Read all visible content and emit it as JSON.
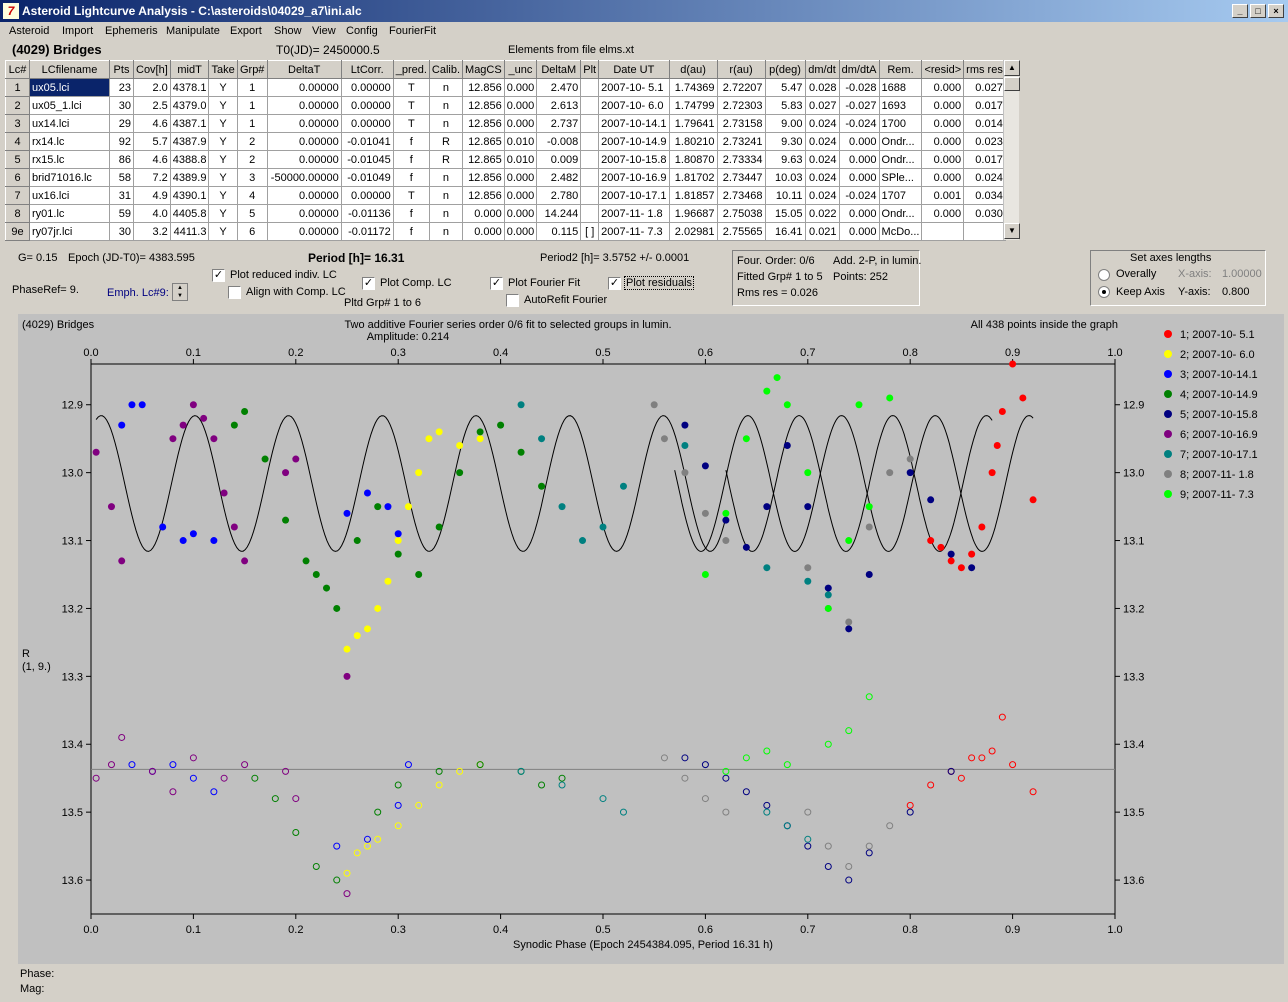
{
  "window": {
    "title": "Asteroid Lightcurve Analysis - C:\\asteroids\\04029_a7\\ini.alc",
    "btn_min": "_",
    "btn_max": "□",
    "btn_close": "×"
  },
  "menu": [
    "Asteroid",
    "Import",
    "Ephemeris",
    "Manipulate",
    "Export",
    "Show",
    "View",
    "Config",
    "FourierFit"
  ],
  "header": {
    "asteroid": "(4029) Bridges",
    "t0": "T0(JD)= 2450000.5",
    "elements": "Elements from file elms.xt"
  },
  "table": {
    "columns": [
      "Lc#",
      "LCfilename",
      "Pts",
      "Cov[h]",
      "midT",
      "Take",
      "Grp#",
      "DeltaT",
      "LtCorr.",
      "_pred.",
      "Calib.",
      "MagCS",
      "_unc",
      "DeltaM",
      "Plt",
      "Date UT",
      "d(au)",
      "r(au)",
      "p(deg)",
      "dm/dt",
      "dm/dtA",
      "Rem.",
      "<resid>",
      "rms res"
    ],
    "rows": [
      [
        "1",
        "ux05.lci",
        "23",
        "2.0",
        "4378.1",
        "Y",
        "1",
        "0.00000",
        "0.00000",
        "T",
        "n",
        "12.856",
        "0.000",
        "2.470",
        "",
        "2007-10- 5.1",
        "1.74369",
        "2.72207",
        "5.47",
        "0.028",
        "-0.028",
        "1688",
        "0.000",
        "0.027"
      ],
      [
        "2",
        "ux05_1.lci",
        "30",
        "2.5",
        "4379.0",
        "Y",
        "1",
        "0.00000",
        "0.00000",
        "T",
        "n",
        "12.856",
        "0.000",
        "2.613",
        "",
        "2007-10- 6.0",
        "1.74799",
        "2.72303",
        "5.83",
        "0.027",
        "-0.027",
        "1693",
        "0.000",
        "0.017"
      ],
      [
        "3",
        "ux14.lci",
        "29",
        "4.6",
        "4387.1",
        "Y",
        "1",
        "0.00000",
        "0.00000",
        "T",
        "n",
        "12.856",
        "0.000",
        "2.737",
        "",
        "2007-10-14.1",
        "1.79641",
        "2.73158",
        "9.00",
        "0.024",
        "-0.024",
        "1700",
        "0.000",
        "0.014"
      ],
      [
        "4",
        "rx14.lc",
        "92",
        "5.7",
        "4387.9",
        "Y",
        "2",
        "0.00000",
        "-0.01041",
        "f",
        "R",
        "12.865",
        "0.010",
        "-0.008",
        "",
        "2007-10-14.9",
        "1.80210",
        "2.73241",
        "9.30",
        "0.024",
        "0.000",
        "Ondr...",
        "0.000",
        "0.023"
      ],
      [
        "5",
        "rx15.lc",
        "86",
        "4.6",
        "4388.8",
        "Y",
        "2",
        "0.00000",
        "-0.01045",
        "f",
        "R",
        "12.865",
        "0.010",
        "0.009",
        "",
        "2007-10-15.8",
        "1.80870",
        "2.73334",
        "9.63",
        "0.024",
        "0.000",
        "Ondr...",
        "0.000",
        "0.017"
      ],
      [
        "6",
        "brid71016.lc",
        "58",
        "7.2",
        "4389.9",
        "Y",
        "3",
        "-50000.00000",
        "-0.01049",
        "f",
        "n",
        "12.856",
        "0.000",
        "2.482",
        "",
        "2007-10-16.9",
        "1.81702",
        "2.73447",
        "10.03",
        "0.024",
        "0.000",
        "SPle...",
        "0.000",
        "0.024"
      ],
      [
        "7",
        "ux16.lci",
        "31",
        "4.9",
        "4390.1",
        "Y",
        "4",
        "0.00000",
        "0.00000",
        "T",
        "n",
        "12.856",
        "0.000",
        "2.780",
        "",
        "2007-10-17.1",
        "1.81857",
        "2.73468",
        "10.11",
        "0.024",
        "-0.024",
        "1707",
        "0.001",
        "0.034"
      ],
      [
        "8",
        "ry01.lc",
        "59",
        "4.0",
        "4405.8",
        "Y",
        "5",
        "0.00000",
        "-0.01136",
        "f",
        "n",
        "0.000",
        "0.000",
        "14.244",
        "",
        "2007-11- 1.8",
        "1.96687",
        "2.75038",
        "15.05",
        "0.022",
        "0.000",
        "Ondr...",
        "0.000",
        "0.030"
      ],
      [
        "9e",
        "ry07jr.lci",
        "30",
        "3.2",
        "4411.3",
        "Y",
        "6",
        "0.00000",
        "-0.01172",
        "f",
        "n",
        "0.000",
        "0.000",
        "0.115",
        "[ ]",
        "2007-11- 7.3",
        "2.02981",
        "2.75565",
        "16.41",
        "0.021",
        "0.000",
        "McDo...",
        "",
        ""
      ]
    ]
  },
  "params": {
    "g": "G= 0.15",
    "epoch": "Epoch (JD-T0)= 4383.595",
    "period": "Period [h]= 16.31",
    "period2": "Period2 [h]= 3.5752 +/- 0.0001",
    "phaseref": "PhaseRef= 9.",
    "emph": "Emph. Lc#9:",
    "pltd": "Pltd Grp#  1   to   6"
  },
  "checks": {
    "reduced": "Plot reduced indiv. LC",
    "align": "Align with Comp. LC",
    "comp": "Plot Comp. LC",
    "fourier": "Plot Fourier Fit",
    "autorefit": "AutoRefit Fourier",
    "residuals": "Plot residuals"
  },
  "fourinfo": {
    "l1": "Four. Order:  0/6",
    "l1b": "Add. 2-P, in lumin.",
    "l2": "Fitted Grp# 1 to 5",
    "l2b": "Points: 252",
    "l3": "Rms res     = 0.026"
  },
  "axes": {
    "title": "Set axes lengths",
    "overall": "Overally",
    "keep": "Keep Axis",
    "xaxis_label": "X-axis:",
    "xaxis_val": "1.00000",
    "yaxis_label": "Y-axis:",
    "yaxis_val": "0.800"
  },
  "status": {
    "phase": "Phase:",
    "mag": "Mag:"
  },
  "chart_data": {
    "type": "scatter",
    "title": "Two additive Fourier series order 0/6 fit to selected groups in lumin.",
    "subtitle": "Amplitude: 0.214",
    "left_label": "(4029) Bridges",
    "right_label": "All 438 points inside the graph",
    "xlabel": "Synodic Phase (Epoch 2454384.095, Period 16.31 h)",
    "ylabel": "R",
    "ylabel2": "(1, 9.)",
    "xlim": [
      0,
      1
    ],
    "ylim": [
      13.65,
      12.84
    ],
    "xticks": [
      "0.0",
      "0.1",
      "0.2",
      "0.3",
      "0.4",
      "0.5",
      "0.6",
      "0.7",
      "0.8",
      "0.9",
      "1.0"
    ],
    "yticks": [
      "12.9",
      "13.0",
      "13.1",
      "13.2",
      "13.3",
      "13.4",
      "13.5",
      "13.6"
    ],
    "residual_level": 13.437,
    "series": [
      {
        "name": "1; 2007-10- 5.1",
        "color": "#ff0000",
        "x": [
          0.82,
          0.83,
          0.84,
          0.85,
          0.86,
          0.87,
          0.88,
          0.885,
          0.89,
          0.9,
          0.91,
          0.92
        ],
        "y": [
          13.1,
          13.11,
          13.13,
          13.14,
          13.12,
          13.08,
          13.0,
          12.96,
          12.91,
          12.84,
          12.89,
          13.04
        ],
        "rx": [
          0.8,
          0.82,
          0.84,
          0.86,
          0.88,
          0.9,
          0.92,
          0.85,
          0.87,
          0.89
        ],
        "ry": [
          13.49,
          13.46,
          13.44,
          13.42,
          13.41,
          13.43,
          13.47,
          13.45,
          13.42,
          13.36
        ]
      },
      {
        "name": "2; 2007-10- 6.0",
        "color": "#ffff00",
        "x": [
          0.25,
          0.26,
          0.27,
          0.28,
          0.29,
          0.3,
          0.31,
          0.32,
          0.33,
          0.34,
          0.36,
          0.38
        ],
        "y": [
          13.26,
          13.24,
          13.23,
          13.2,
          13.16,
          13.1,
          13.05,
          13.0,
          12.95,
          12.94,
          12.96,
          12.95
        ],
        "rx": [
          0.25,
          0.26,
          0.27,
          0.28,
          0.3,
          0.32,
          0.34,
          0.36,
          0.38
        ],
        "ry": [
          13.59,
          13.56,
          13.55,
          13.54,
          13.52,
          13.49,
          13.46,
          13.44,
          13.43
        ]
      },
      {
        "name": "3; 2007-10-14.1",
        "color": "#0000ff",
        "x": [
          0.03,
          0.04,
          0.05,
          0.07,
          0.09,
          0.1,
          0.12,
          0.25,
          0.27,
          0.29,
          0.3
        ],
        "y": [
          12.93,
          12.9,
          12.9,
          13.08,
          13.1,
          13.09,
          13.1,
          13.06,
          13.03,
          13.05,
          13.09
        ],
        "rx": [
          0.04,
          0.06,
          0.08,
          0.1,
          0.12,
          0.24,
          0.27,
          0.3,
          0.31
        ],
        "ry": [
          13.43,
          13.44,
          13.43,
          13.45,
          13.47,
          13.55,
          13.54,
          13.49,
          13.43
        ]
      },
      {
        "name": "4; 2007-10-14.9",
        "color": "#008000",
        "x": [
          0.14,
          0.15,
          0.17,
          0.19,
          0.21,
          0.22,
          0.23,
          0.24,
          0.26,
          0.28,
          0.3,
          0.32,
          0.34,
          0.36,
          0.38,
          0.4,
          0.42,
          0.44
        ],
        "y": [
          12.93,
          12.91,
          12.98,
          13.07,
          13.13,
          13.15,
          13.17,
          13.2,
          13.1,
          13.05,
          13.12,
          13.15,
          13.08,
          13.0,
          12.94,
          12.93,
          12.97,
          13.02
        ],
        "rx": [
          0.16,
          0.18,
          0.2,
          0.22,
          0.24,
          0.28,
          0.3,
          0.34,
          0.38,
          0.42,
          0.44,
          0.46
        ],
        "ry": [
          13.45,
          13.48,
          13.53,
          13.58,
          13.6,
          13.5,
          13.46,
          13.44,
          13.43,
          13.44,
          13.46,
          13.45
        ]
      },
      {
        "name": "5; 2007-10-15.8",
        "color": "#000080",
        "x": [
          0.58,
          0.6,
          0.62,
          0.64,
          0.66,
          0.68,
          0.7,
          0.72,
          0.74,
          0.76,
          0.8,
          0.82,
          0.84,
          0.86
        ],
        "y": [
          12.93,
          12.99,
          13.07,
          13.11,
          13.05,
          12.96,
          13.05,
          13.17,
          13.23,
          13.15,
          13.0,
          13.04,
          13.12,
          13.14
        ],
        "rx": [
          0.58,
          0.6,
          0.62,
          0.64,
          0.66,
          0.68,
          0.7,
          0.72,
          0.74,
          0.76,
          0.8,
          0.84
        ],
        "ry": [
          13.42,
          13.43,
          13.45,
          13.47,
          13.49,
          13.52,
          13.55,
          13.58,
          13.6,
          13.56,
          13.5,
          13.44
        ]
      },
      {
        "name": "6; 2007-10-16.9",
        "color": "#800080",
        "x": [
          0.005,
          0.02,
          0.03,
          0.08,
          0.09,
          0.1,
          0.11,
          0.12,
          0.13,
          0.14,
          0.15,
          0.19,
          0.2,
          0.25
        ],
        "y": [
          12.97,
          13.05,
          13.13,
          12.95,
          12.93,
          12.9,
          12.92,
          12.95,
          13.03,
          13.08,
          13.13,
          13.0,
          12.98,
          13.3
        ],
        "rx": [
          0.005,
          0.02,
          0.03,
          0.06,
          0.08,
          0.1,
          0.13,
          0.15,
          0.19,
          0.2,
          0.25
        ],
        "ry": [
          13.45,
          13.43,
          13.39,
          13.44,
          13.47,
          13.42,
          13.45,
          13.43,
          13.44,
          13.48,
          13.62
        ]
      },
      {
        "name": "7; 2007-10-17.1",
        "color": "#008080",
        "x": [
          0.42,
          0.44,
          0.46,
          0.48,
          0.5,
          0.52,
          0.58,
          0.66,
          0.7,
          0.72
        ],
        "y": [
          12.9,
          12.95,
          13.05,
          13.1,
          13.08,
          13.02,
          12.96,
          13.14,
          13.16,
          13.18
        ],
        "rx": [
          0.42,
          0.46,
          0.5,
          0.52,
          0.66,
          0.68,
          0.7
        ],
        "ry": [
          13.44,
          13.46,
          13.48,
          13.5,
          13.5,
          13.52,
          13.54
        ]
      },
      {
        "name": "8; 2007-11- 1.8",
        "color": "#808080",
        "x": [
          0.55,
          0.56,
          0.58,
          0.6,
          0.62,
          0.7,
          0.72,
          0.74,
          0.76,
          0.78,
          0.8
        ],
        "y": [
          12.9,
          12.95,
          13.0,
          13.06,
          13.1,
          13.14,
          13.2,
          13.22,
          13.08,
          13.0,
          12.98
        ],
        "rx": [
          0.56,
          0.58,
          0.6,
          0.62,
          0.7,
          0.72,
          0.74,
          0.76,
          0.78
        ],
        "ry": [
          13.42,
          13.45,
          13.48,
          13.5,
          13.5,
          13.55,
          13.58,
          13.55,
          13.52
        ]
      },
      {
        "name": "9; 2007-11- 7.3",
        "color": "#00ff00",
        "x": [
          0.6,
          0.62,
          0.64,
          0.66,
          0.67,
          0.68,
          0.7,
          0.72,
          0.74,
          0.75,
          0.76,
          0.78
        ],
        "y": [
          13.15,
          13.06,
          12.95,
          12.88,
          12.86,
          12.9,
          13.0,
          13.2,
          13.1,
          12.9,
          13.05,
          12.89
        ],
        "rx": [
          0.62,
          0.64,
          0.66,
          0.68,
          0.72,
          0.74,
          0.76
        ],
        "ry": [
          13.44,
          13.42,
          13.41,
          13.43,
          13.4,
          13.38,
          13.33
        ]
      }
    ],
    "fourier_curves": [
      {
        "x0": 0.005,
        "x1": 0.62,
        "period": 0.0915,
        "center": 13.016,
        "amp": 0.1,
        "phase": 0.01
      },
      {
        "x0": 0.57,
        "x1": 0.92,
        "period": 0.0915,
        "center": 13.016,
        "amp": 0.1,
        "phase": 0.55
      },
      {
        "x0": 0.62,
        "x1": 0.88,
        "period": 0.0915,
        "center": 13.016,
        "amp": 0.1,
        "phase": 0.6
      }
    ]
  }
}
